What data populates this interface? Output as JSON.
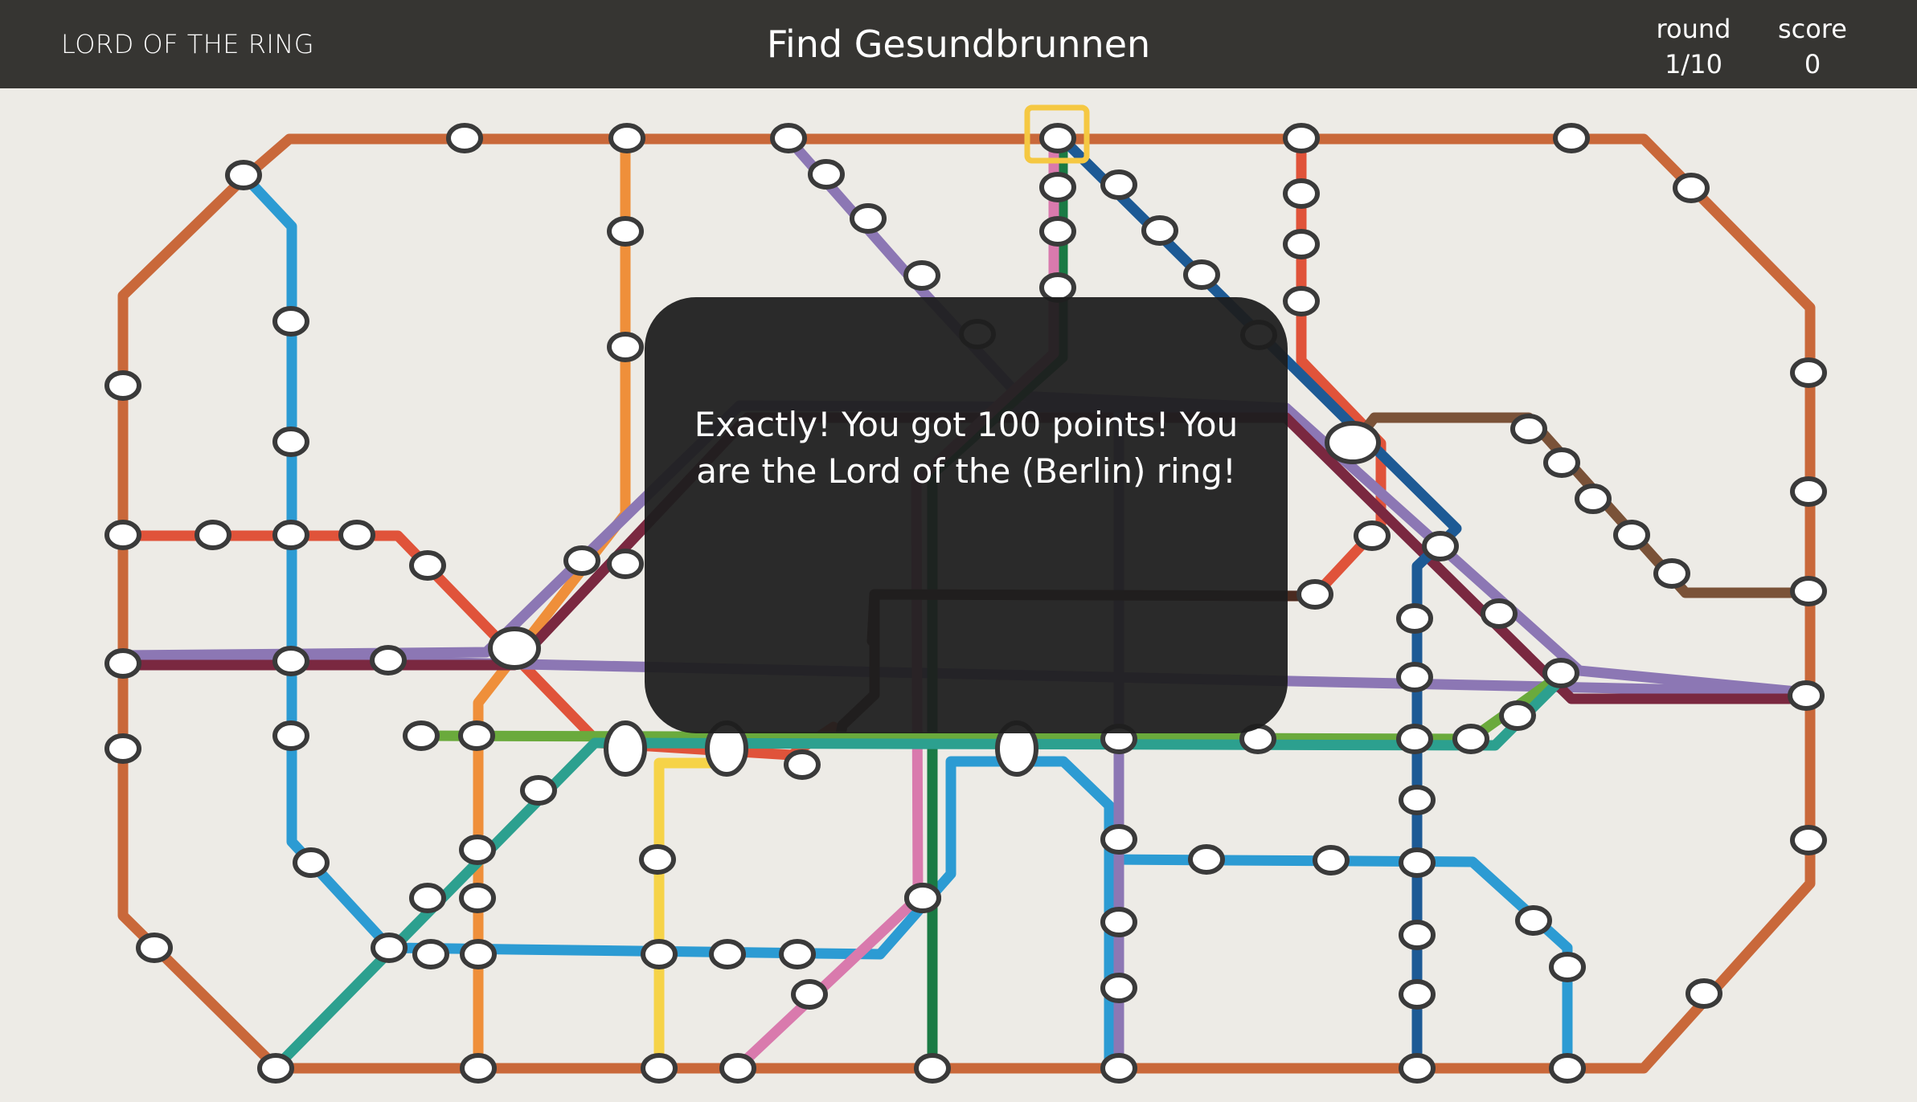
{
  "header": {
    "brand": "LORD OF THE RING",
    "prompt": "Find Gesundbrunnen",
    "round_label": "round",
    "round_value": "1/10",
    "score_label": "score",
    "score_value": "0"
  },
  "overlay": {
    "message": "Exactly! You got 100 points! You are the Lord of the (Berlin) ring!"
  },
  "colors": {
    "ring": "#c9683a",
    "blue_light": "#2c9bd3",
    "red": "#e0533a",
    "orange": "#ef8f3a",
    "purple": "#8c77b4",
    "maroon": "#7a2840",
    "green": "#1a7a44",
    "pink": "#d97aad",
    "navy": "#1d5a95",
    "brown": "#7a5238",
    "lime": "#6aaa3c",
    "teal": "#2ca08f",
    "yellow": "#f6d348",
    "highlight": "#f5c842"
  },
  "map": {
    "highlighted_station": "Gesundbrunnen"
  }
}
